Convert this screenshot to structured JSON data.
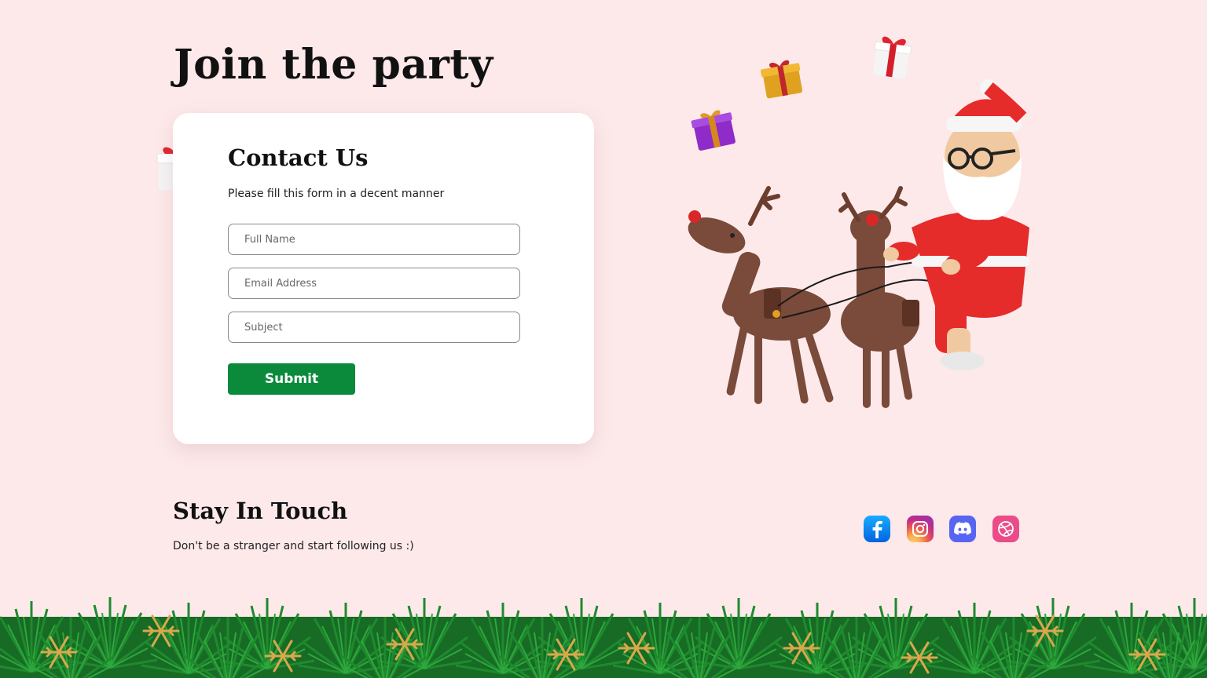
{
  "hero": {
    "title": "Join the party"
  },
  "contact": {
    "title": "Contact Us",
    "subtitle": "Please fill this form in a decent manner",
    "full_name_placeholder": "Full Name",
    "email_placeholder": "Email Address",
    "subject_placeholder": "Subject",
    "submit_label": "Submit",
    "accent_color": "#0b8a3c"
  },
  "touch": {
    "title": "Stay In Touch",
    "subtitle": "Don't be a stranger and start following us :)"
  },
  "social": [
    {
      "icon": "facebook-icon",
      "color": "#1877f2"
    },
    {
      "icon": "instagram-icon",
      "color": "#e1306c"
    },
    {
      "icon": "discord-icon",
      "color": "#5865f2"
    },
    {
      "icon": "dribbble-icon",
      "color": "#ea4c89"
    }
  ],
  "colors": {
    "background": "#fde9ea",
    "card": "#ffffff",
    "garland": "#1f8a2e"
  }
}
